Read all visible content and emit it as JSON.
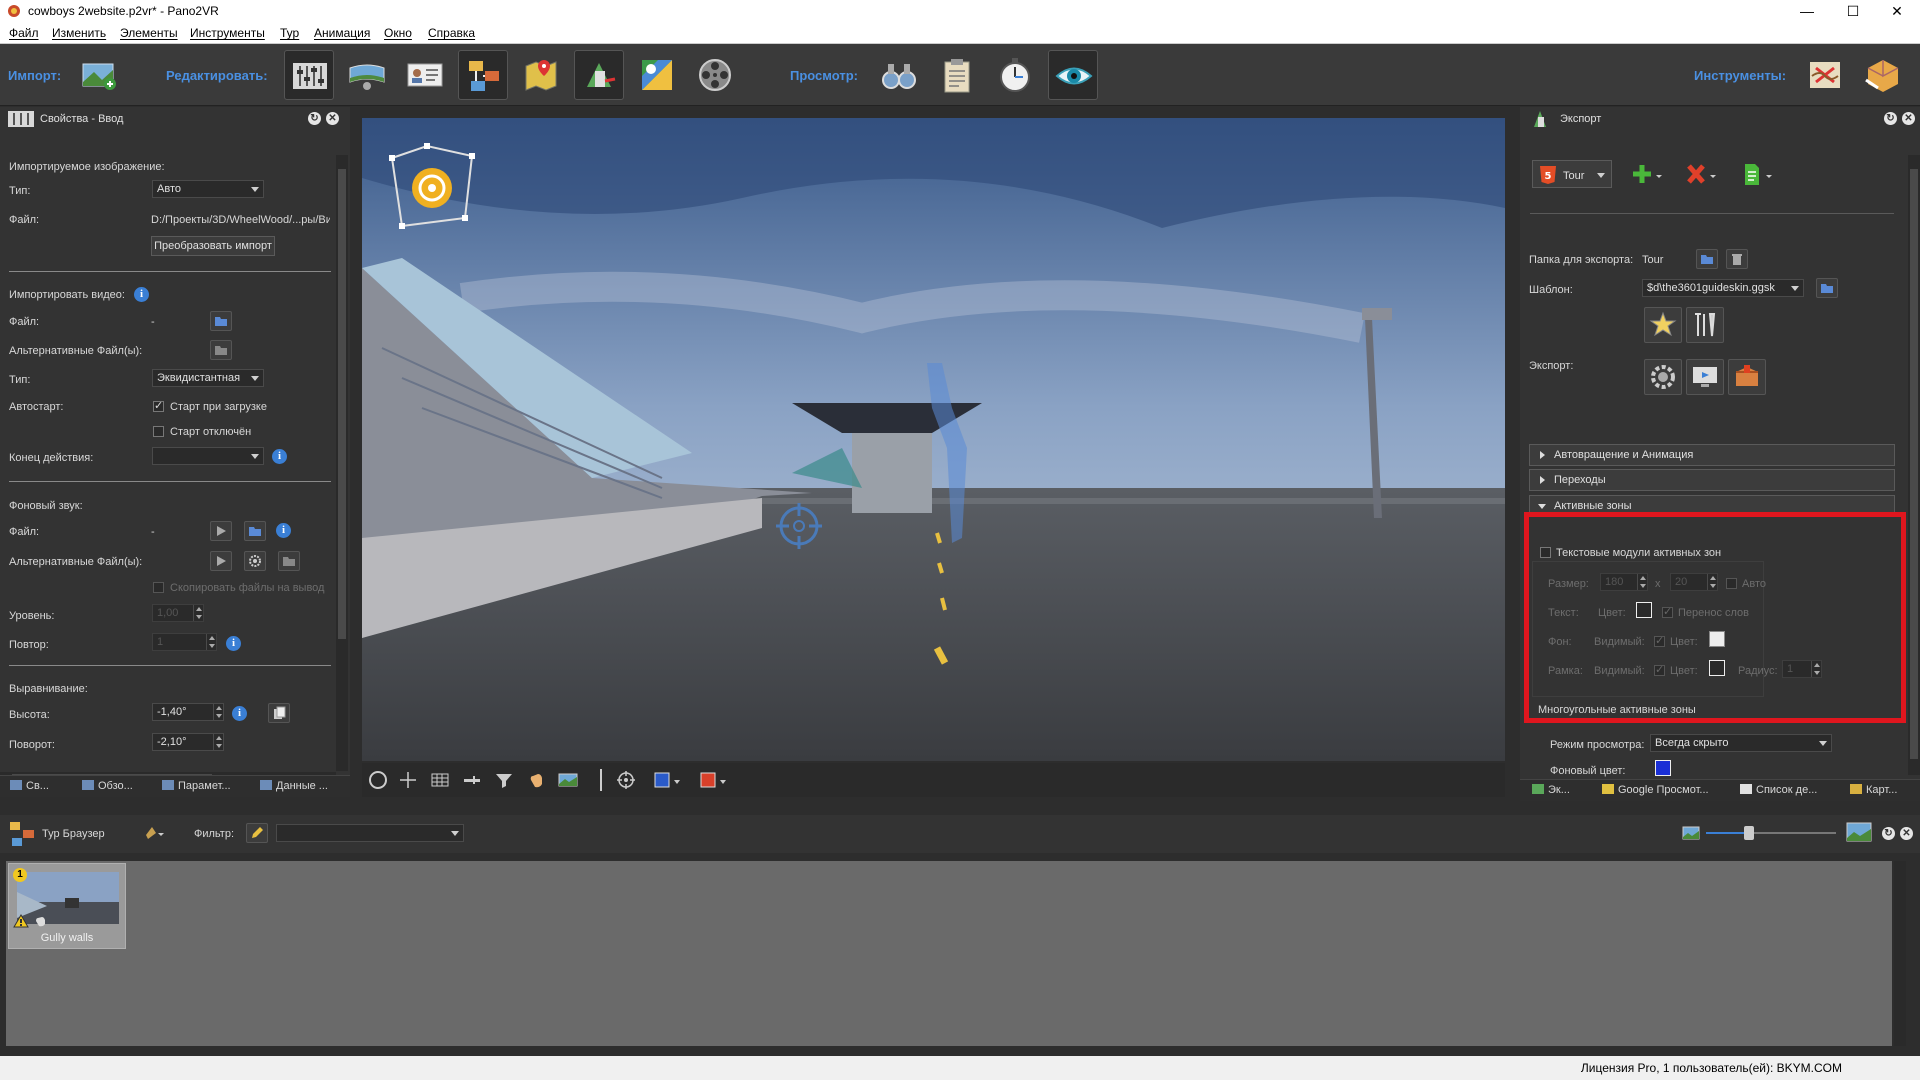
{
  "window": {
    "title": "cowboys 2website.p2vr* - Pano2VR",
    "minimize_icon": "minimize-icon",
    "maximize_icon": "maximize-icon",
    "close_icon": "close-icon"
  },
  "menu": [
    "Файл",
    "Изменить",
    "Элементы",
    "Инструменты",
    "Тур",
    "Анимация",
    "Окно",
    "Справка"
  ],
  "toolbar": {
    "import_label": "Импорт:",
    "edit_label": "Редактировать:",
    "view_label": "Просмотр:",
    "tools_label": "Инструменты:"
  },
  "left_panel": {
    "title": "Свойства - Ввод",
    "imported_image_heading": "Импортируемое изображение:",
    "type_label": "Тип:",
    "type_value": "Авто",
    "file_label": "Файл:",
    "file_value": "D:/Проекты/3D/WheelWood/...ры/Ви",
    "convert_button": "Преобразовать импорт",
    "import_video_heading": "Импортировать видео:",
    "video_file_label": "Файл:",
    "video_file_value": "-",
    "alt_files_label": "Альтернативные Файл(ы):",
    "video_type_label": "Тип:",
    "video_type_value": "Эквидистантная",
    "autostart_label": "Автостарт:",
    "start_on_load": "Старт при загрузке",
    "start_disabled": "Старт отключён",
    "end_action_label": "Конец действия:",
    "end_action_value": "",
    "bg_sound_heading": "Фоновый звук:",
    "sound_file_label": "Файл:",
    "sound_file_value": "-",
    "sound_alt_files_label": "Альтернативные Файл(ы):",
    "copy_files_label": "Скопировать файлы на вывод",
    "level_label": "Уровень:",
    "level_value": "1,00",
    "repeat_label": "Повтор:",
    "repeat_value": "1",
    "alignment_heading": "Выравнивание:",
    "height_label": "Высота:",
    "height_value": "-1,40°",
    "rotation_label": "Поворот:",
    "rotation_value": "-2,10°",
    "tabs": [
      "Св...",
      "Обзо...",
      "Парамет...",
      "Данные ..."
    ]
  },
  "right_panel": {
    "title": "Экспорт",
    "format_value": "Tour",
    "export_folder_label": "Папка для экспорта:",
    "export_folder_value": "Tour",
    "template_label": "Шаблон:",
    "template_value": "$d\\the3601guideskin.ggsk",
    "export_label": "Экспорт:",
    "section_autorotate": "Автовращение и Анимация",
    "section_transitions": "Переходы",
    "section_hotspots": "Активные зоны",
    "text_modules_label": "Текстовые модули активных зон",
    "size_label": "Размер:",
    "size_w": "180",
    "size_x": "x",
    "size_h": "20",
    "auto_label": "Авто",
    "text_label": "Текст:",
    "color_label": "Цвет:",
    "word_wrap_label": "Перенос слов",
    "bg_label": "Фон:",
    "visible_label": "Видимый:",
    "frame_label": "Рамка:",
    "radius_label": "Радиус:",
    "radius_value": "1",
    "polygon_hotspots_label": "Многоугольные активные зоны",
    "view_mode_label": "Режим просмотра:",
    "view_mode_value": "Всегда скрыто",
    "bg_color_label": "Фоновый цвет:",
    "tabs": [
      "Эк...",
      "Google Просмот...",
      "Список де...",
      "Карт..."
    ]
  },
  "tour_browser": {
    "title": "Тур Браузер",
    "filter_label": "Фильтр:",
    "filter_value": "",
    "thumbnail_label": "Gully walls",
    "badge": "1"
  },
  "status": {
    "license": "Лицензия Pro, 1 пользователь(ей): BKYM.COM"
  },
  "colors": {
    "accent_blue": "#4a90e2",
    "highlight_red": "#e0161e",
    "panel_bg": "#333333",
    "hotspot_bg_color": "#eeeeee",
    "polygon_bg_color": "#1a2fd6"
  }
}
